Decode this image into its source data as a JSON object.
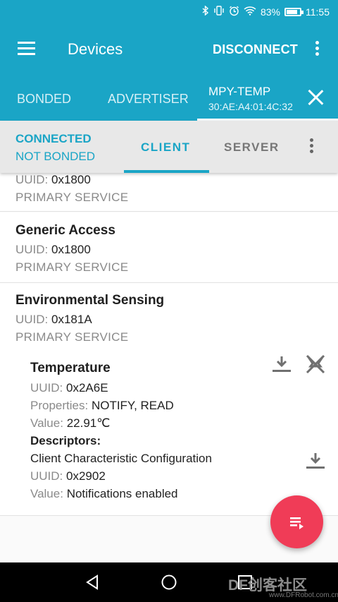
{
  "status_bar": {
    "battery": "83%",
    "time": "11:55",
    "battery_level": 0.83
  },
  "app_bar": {
    "title": "Devices",
    "action": "DISCONNECT"
  },
  "tabs": {
    "bonded": "BONDED",
    "advertiser": "ADVERTISER",
    "device_name": "MPY-TEMP",
    "device_address": "30:AE:A4:01:4C:32"
  },
  "connection": {
    "state": "CONNECTED",
    "bond": "NOT BONDED",
    "client_tab": "CLIENT",
    "server_tab": "SERVER"
  },
  "services": [
    {
      "name": "",
      "uuid_label": "UUID:",
      "uuid": "0x1800",
      "type": "PRIMARY SERVICE"
    },
    {
      "name": "Generic Access",
      "uuid_label": "UUID:",
      "uuid": "0x1800",
      "type": "PRIMARY SERVICE"
    },
    {
      "name": "Environmental Sensing",
      "uuid_label": "UUID:",
      "uuid": "0x181A",
      "type": "PRIMARY SERVICE"
    }
  ],
  "characteristic": {
    "name": "Temperature",
    "uuid_label": "UUID:",
    "uuid": "0x2A6E",
    "properties_label": "Properties:",
    "properties": "NOTIFY, READ",
    "value_label": "Value:",
    "value": "22.91℃",
    "descriptors_label": "Descriptors:",
    "descriptor": {
      "name": "Client Characteristic Configuration",
      "uuid_label": "UUID:",
      "uuid": "0x2902",
      "value_label": "Value:",
      "value": "Notifications enabled"
    }
  },
  "watermark": {
    "brand": "DF创客社区",
    "url": "www.DFRobot.com.cn"
  },
  "icons": {
    "menu": "menu-icon",
    "overflow": "overflow-menu-icon",
    "close": "close-icon",
    "download": "download-icon",
    "notify": "notifications-off-icon",
    "log": "log-icon",
    "back": "back-icon",
    "home": "home-icon",
    "recents": "recents-icon",
    "bluetooth": "bluetooth-icon",
    "vibrate": "vibrate-icon",
    "alarm": "alarm-icon",
    "wifi": "wifi-icon"
  },
  "colors": {
    "primary": "#1aa5c6",
    "accent": "#f03c57",
    "nav": "#000000"
  }
}
